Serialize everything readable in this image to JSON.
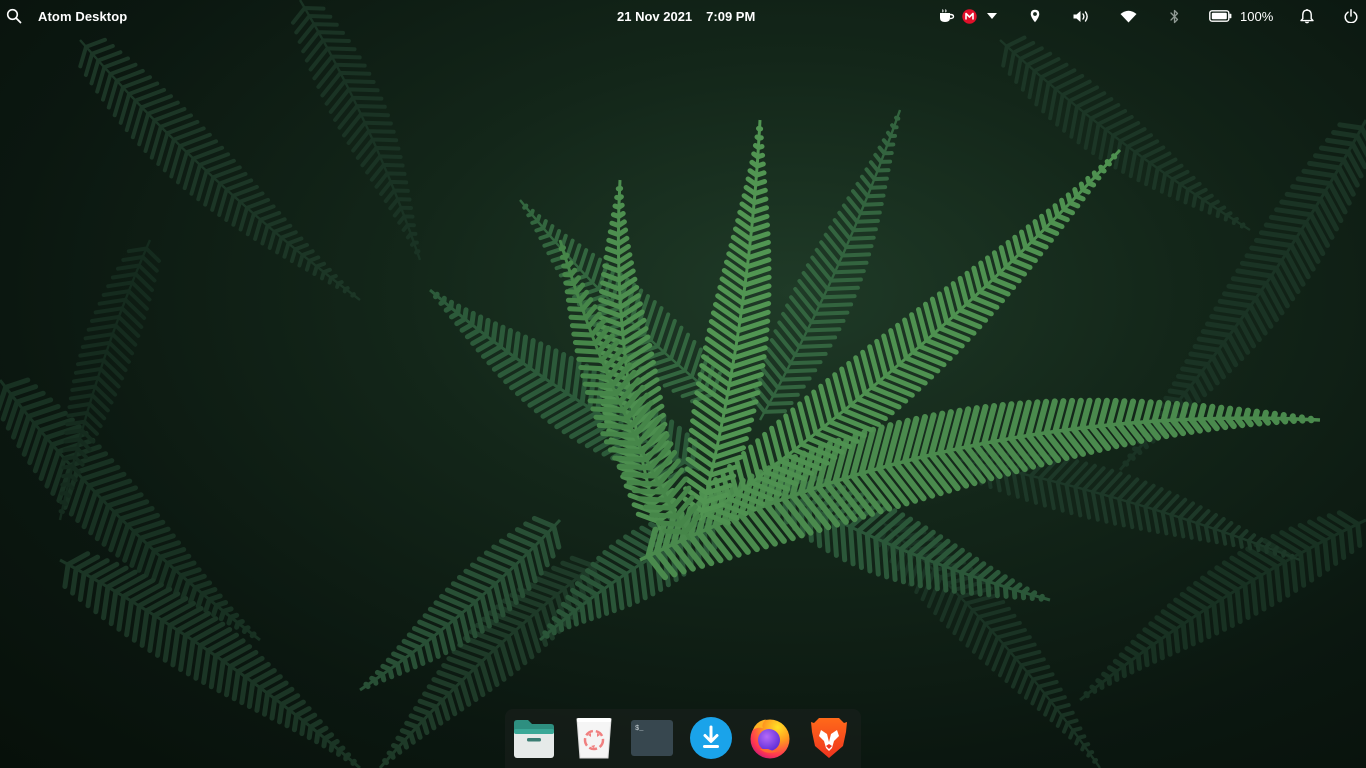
{
  "panel": {
    "app_title": "Atom Desktop",
    "date": "21 Nov 2021",
    "time": "7:09 PM",
    "battery_percent": "100%",
    "battery_level": 1.0
  },
  "tray_icons": [
    "search-icon",
    "coffee-icon",
    "mail-icon",
    "dropdown-icon",
    "location-icon",
    "volume-icon",
    "wifi-icon",
    "bluetooth-icon",
    "battery-icon",
    "notification-bell-icon",
    "power-icon"
  ],
  "dock": {
    "items": [
      "files-icon",
      "trash-icon",
      "terminal-icon",
      "download-icon",
      "firefox-icon",
      "brave-icon"
    ],
    "terminal_prompt": "$_"
  },
  "colors": {
    "panel_text": "#ffffff",
    "mail_badge": "#e0102a",
    "downloader_blue": "#1aa3ea",
    "files_teal": "#3aa897",
    "terminal_bg": "#37474f",
    "brave_orange": "#f05a24"
  }
}
